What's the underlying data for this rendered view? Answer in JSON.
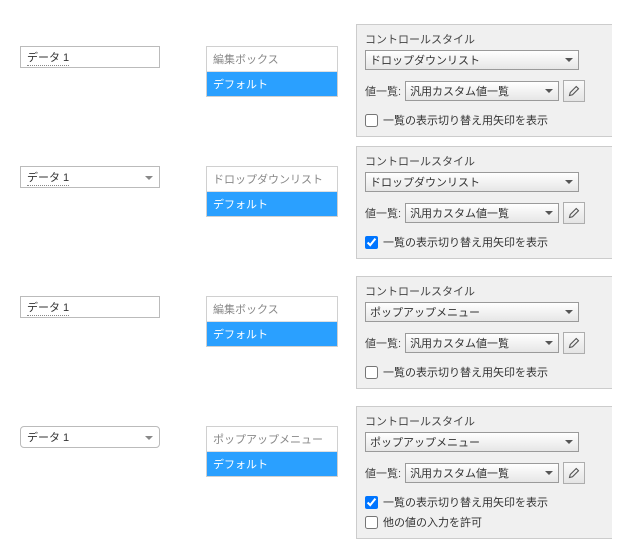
{
  "rows": [
    {
      "field_text": "データ 1",
      "field_kind": "edit",
      "styles_header": "編集ボックス",
      "styles_selected": "デフォルト",
      "panel": {
        "title": "コントロールスタイル",
        "control_style": "ドロップダウンリスト",
        "value_list_label": "値一覧:",
        "value_list": "汎用カスタム値一覧",
        "chk_arrow_label": "一覧の表示切り替え用矢印を表示",
        "chk_arrow_checked": false
      }
    },
    {
      "field_text": "データ 1",
      "field_kind": "combo",
      "styles_header": "ドロップダウンリスト",
      "styles_selected": "デフォルト",
      "panel": {
        "title": "コントロールスタイル",
        "control_style": "ドロップダウンリスト",
        "value_list_label": "値一覧:",
        "value_list": "汎用カスタム値一覧",
        "chk_arrow_label": "一覧の表示切り替え用矢印を表示",
        "chk_arrow_checked": true
      }
    },
    {
      "field_text": "データ 1",
      "field_kind": "edit",
      "styles_header": "編集ボックス",
      "styles_selected": "デフォルト",
      "panel": {
        "title": "コントロールスタイル",
        "control_style": "ポップアップメニュー",
        "value_list_label": "値一覧:",
        "value_list": "汎用カスタム値一覧",
        "chk_arrow_label": "一覧の表示切り替え用矢印を表示",
        "chk_arrow_checked": false
      }
    },
    {
      "field_text": "データ 1",
      "field_kind": "popup",
      "styles_header": "ポップアップメニュー",
      "styles_selected": "デフォルト",
      "panel": {
        "title": "コントロールスタイル",
        "control_style": "ポップアップメニュー",
        "value_list_label": "値一覧:",
        "value_list": "汎用カスタム値一覧",
        "chk_arrow_label": "一覧の表示切り替え用矢印を表示",
        "chk_arrow_checked": true,
        "chk_other_label": "他の値の入力を許可",
        "chk_other_checked": false
      }
    }
  ]
}
